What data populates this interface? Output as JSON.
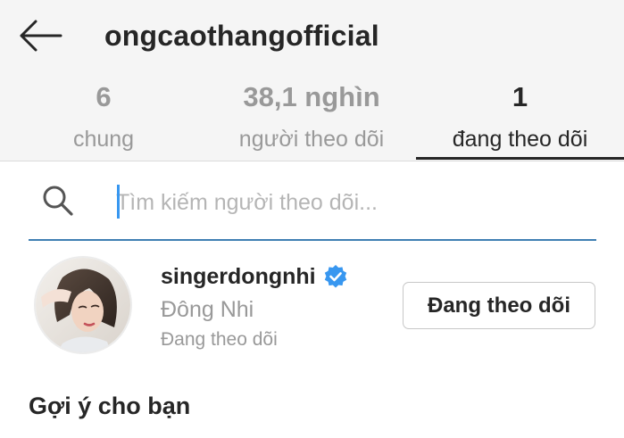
{
  "header": {
    "username": "ongcaothangofficial"
  },
  "tabs": [
    {
      "count": "6",
      "label": "chung",
      "active": false
    },
    {
      "count": "38,1 nghìn",
      "label": "người theo dõi",
      "active": false
    },
    {
      "count": "1",
      "label": "đang theo dõi",
      "active": true
    }
  ],
  "search": {
    "placeholder": "Tìm kiếm người theo dõi...",
    "value": ""
  },
  "following": [
    {
      "handle": "singerdongnhi",
      "verified": true,
      "full_name": "Đông Nhi",
      "status": "Đang theo dõi",
      "button_label": "Đang theo dõi"
    }
  ],
  "suggestions": {
    "title": "Gợi ý cho bạn"
  },
  "colors": {
    "header_bg": "#f5f5f5",
    "text_primary": "#262626",
    "text_secondary": "#999999",
    "accent_blue": "#3897f0",
    "search_underline": "#3f7fb3"
  }
}
